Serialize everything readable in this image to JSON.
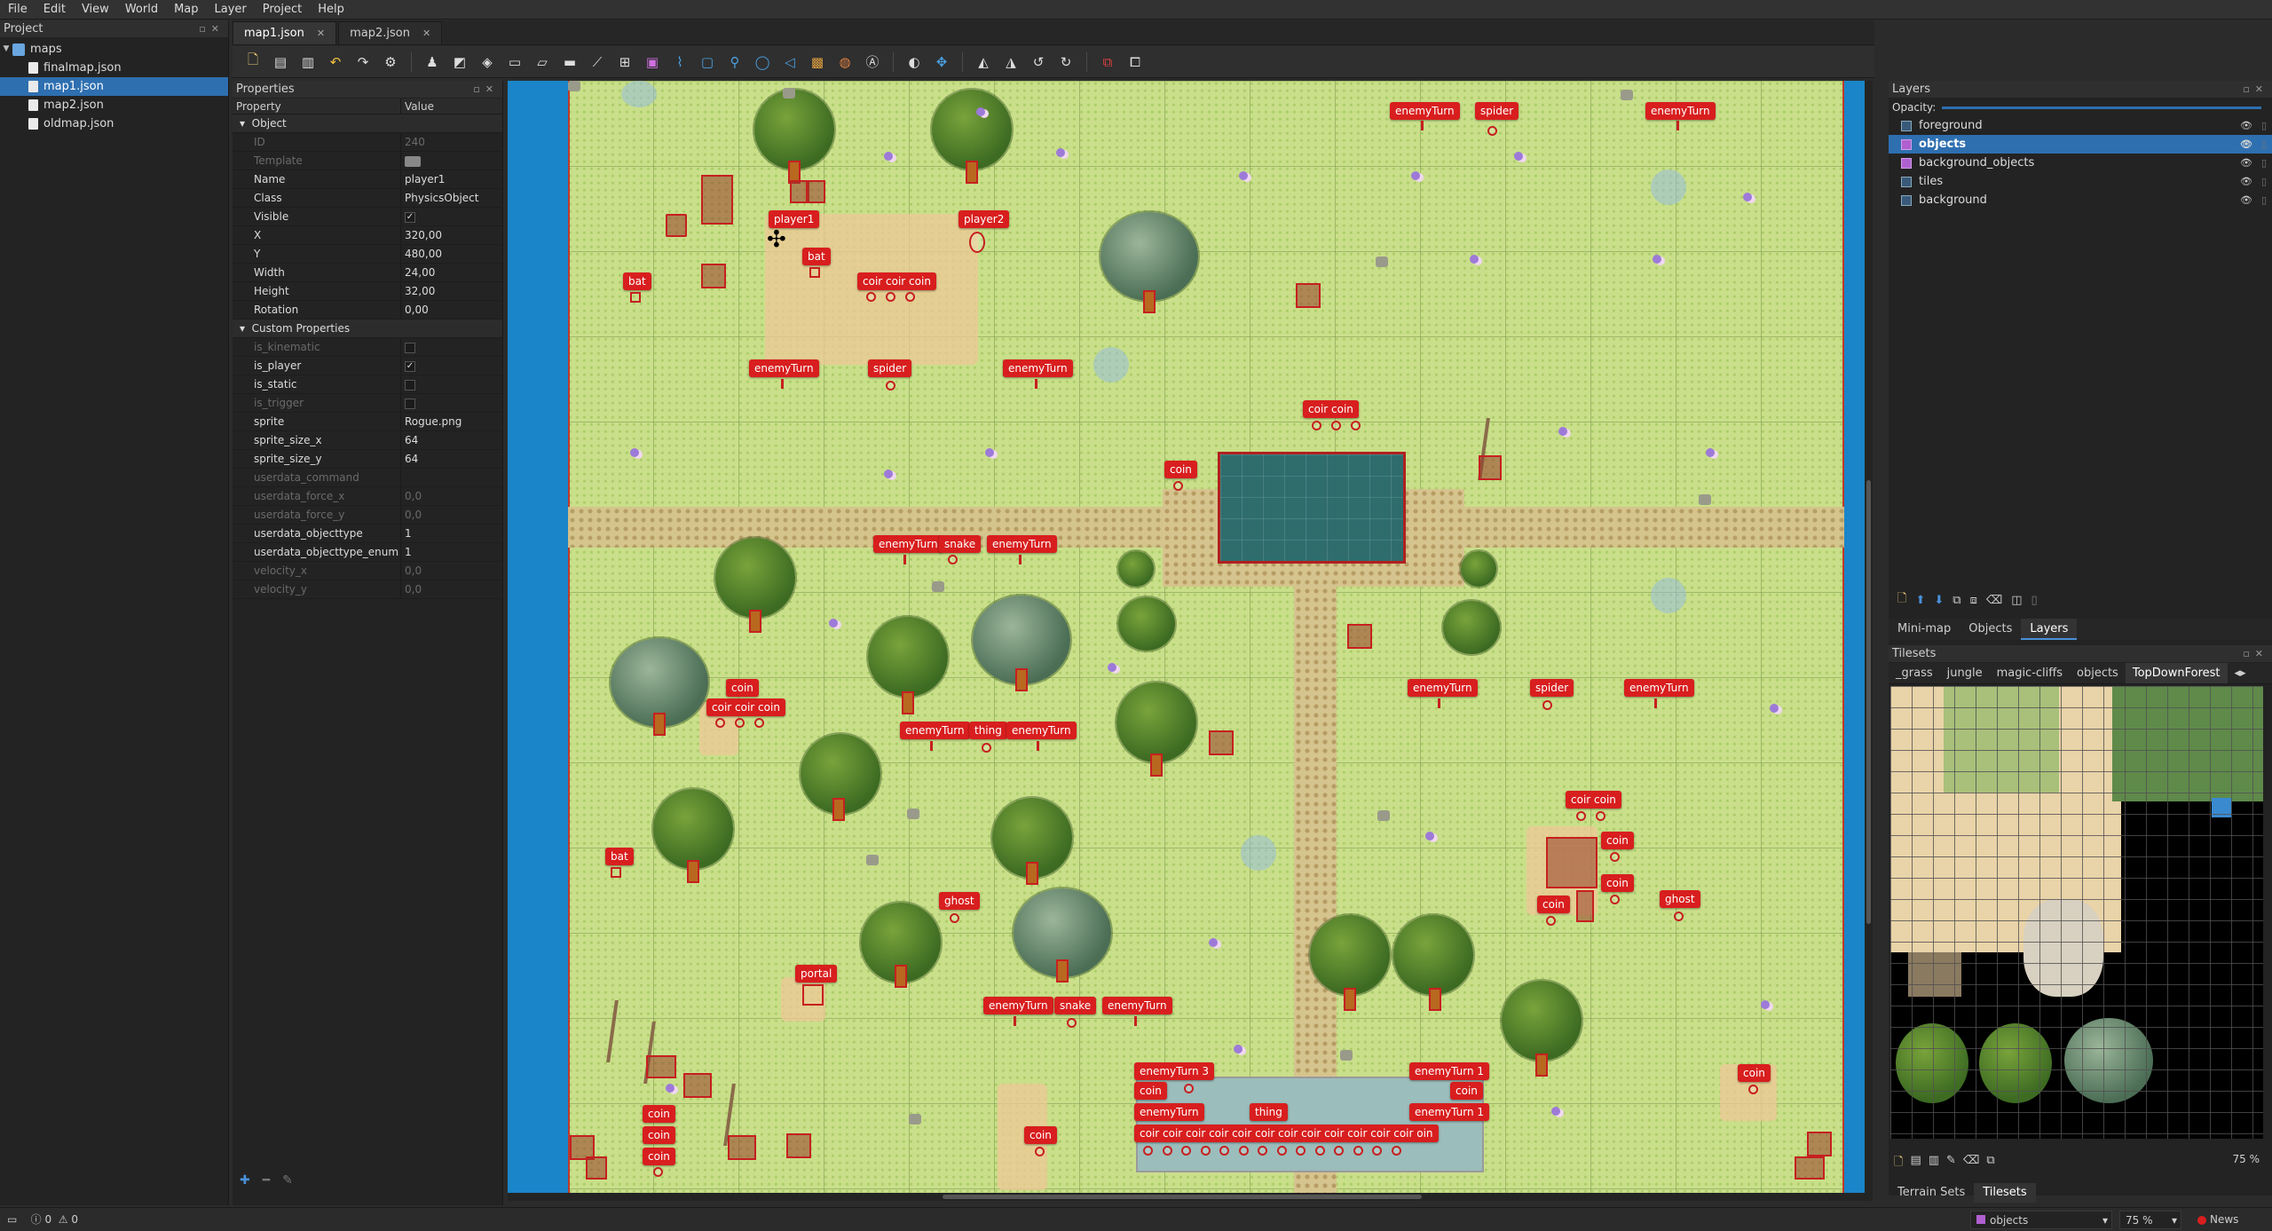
{
  "menu": [
    "File",
    "Edit",
    "View",
    "World",
    "Map",
    "Layer",
    "Project",
    "Help"
  ],
  "project": {
    "title": "Project",
    "root": "maps",
    "files": [
      "finalmap.json",
      "map1.json",
      "map2.json",
      "oldmap.json"
    ],
    "selected": "map1.json"
  },
  "tabs": [
    {
      "label": "map1.json",
      "active": true
    },
    {
      "label": "map2.json",
      "active": false
    }
  ],
  "properties": {
    "title": "Properties",
    "col_property": "Property",
    "col_value": "Value",
    "object_group": "Object",
    "custom_group": "Custom Properties",
    "object_rows": [
      {
        "k": "ID",
        "v": "240",
        "dim": true
      },
      {
        "k": "Template",
        "v": "",
        "dim": true
      },
      {
        "k": "Name",
        "v": "player1"
      },
      {
        "k": "Class",
        "v": "PhysicsObject"
      },
      {
        "k": "Visible",
        "v": "✓"
      },
      {
        "k": "X",
        "v": "320,00"
      },
      {
        "k": "Y",
        "v": "480,00"
      },
      {
        "k": "Width",
        "v": "24,00"
      },
      {
        "k": "Height",
        "v": "32,00"
      },
      {
        "k": "Rotation",
        "v": "0,00"
      }
    ],
    "custom_rows": [
      {
        "k": "is_kinematic",
        "v": "",
        "dim": true
      },
      {
        "k": "is_player",
        "v": "✓"
      },
      {
        "k": "is_static",
        "v": ""
      },
      {
        "k": "is_trigger",
        "v": "",
        "dim": true
      },
      {
        "k": "sprite",
        "v": "Rogue.png"
      },
      {
        "k": "sprite_size_x",
        "v": "64"
      },
      {
        "k": "sprite_size_y",
        "v": "64"
      },
      {
        "k": "userdata_command",
        "v": "",
        "dim": true
      },
      {
        "k": "userdata_force_x",
        "v": "0,0",
        "dim": true
      },
      {
        "k": "userdata_force_y",
        "v": "0,0",
        "dim": true
      },
      {
        "k": "userdata_objecttype",
        "v": "1"
      },
      {
        "k": "userdata_objecttype_enum",
        "v": "1"
      },
      {
        "k": "velocity_x",
        "v": "0,0",
        "dim": true
      },
      {
        "k": "velocity_y",
        "v": "0,0",
        "dim": true
      }
    ]
  },
  "map_labels": {
    "enemyTurn": "enemyTurn",
    "spider": "spider",
    "player1": "player1",
    "player2": "player2",
    "bat": "bat",
    "coin": "coin",
    "coin3": "coir coir coin",
    "coin2": "coir coin",
    "snake": "snake",
    "thing": "thing",
    "ghost": "ghost",
    "portal": "portal",
    "enemyTurn3": "enemyTurn 3",
    "enemyTurnCut": "enemyTurn 1",
    "coinRow": "coir coir coir coir coir coir coir coir coir coir coir coir oin"
  },
  "layers": {
    "title": "Layers",
    "opacity_label": "Opacity:",
    "items": [
      {
        "name": "foreground",
        "type": "tile"
      },
      {
        "name": "objects",
        "type": "object",
        "selected": true
      },
      {
        "name": "background_objects",
        "type": "object"
      },
      {
        "name": "tiles",
        "type": "tile"
      },
      {
        "name": "background",
        "type": "tile"
      }
    ]
  },
  "dock_tabs": [
    "Mini-map",
    "Objects",
    "Layers"
  ],
  "tilesets": {
    "title": "Tilesets",
    "tabs": [
      "_grass",
      "jungle",
      "magic-cliffs",
      "objects",
      "TopDownForest"
    ],
    "active": "TopDownForest",
    "zoom": "75 %"
  },
  "bottom_tabs": [
    "Terrain Sets",
    "Tilesets"
  ],
  "status": {
    "errors": "0",
    "warnings": "0",
    "layer": "objects",
    "zoom": "75 %",
    "news": "News"
  },
  "colors": {
    "accent": "#2e6fb0",
    "object_label": "#d81e1e",
    "canvas_bg": "#1a85c8"
  }
}
